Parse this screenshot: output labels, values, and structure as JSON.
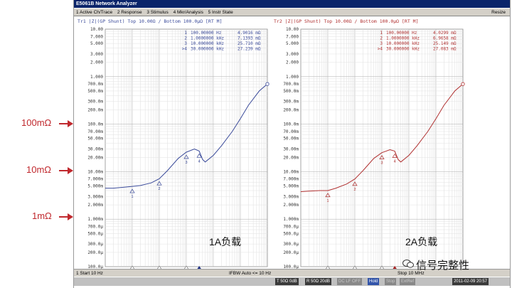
{
  "window": {
    "title": "E5061B Network Analyzer",
    "resize": "Resize"
  },
  "menu": [
    "1 Active Ch/Trace",
    "2 Response",
    "3 Stimulus",
    "4 Mkr/Analysis",
    "5 Instr State"
  ],
  "left_trace": {
    "header": "Tr1 |Z|(GP Shunt)  Top 10.00Ω / Bottom 100.0µΩ [RT M]",
    "color": "#3a4a9a",
    "markers": [
      {
        "id": "1",
        "freq": "100.00000 Hz",
        "val": "4.9016 mΩ"
      },
      {
        "id": "2",
        "freq": "1.0000000 kHz",
        "val": "7.1393 mΩ"
      },
      {
        "id": "3",
        "freq": "10.000000 kHz",
        "val": "25.710 mΩ"
      },
      {
        "id": ">4",
        "freq": "30.000000 kHz",
        "val": "27.239 mΩ"
      }
    ],
    "load_label": "1A负载"
  },
  "right_trace": {
    "header": "Tr2 |Z|(GP Shunt)  Top 10.00Ω / Bottom 100.0µΩ [RT M]",
    "color": "#b03030",
    "markers": [
      {
        "id": "1",
        "freq": "100.00000 Hz",
        "val": "4.0299 mΩ"
      },
      {
        "id": "2",
        "freq": "1.0000000 kHz",
        "val": "6.9658 mΩ"
      },
      {
        "id": "3",
        "freq": "10.000000 kHz",
        "val": "25.149 mΩ"
      },
      {
        "id": ">4",
        "freq": "30.000000 kHz",
        "val": "27.083 mΩ"
      }
    ],
    "load_label": "2A负载"
  },
  "y_ticks": [
    "10.00",
    "7.000",
    "5.000",
    "3.000",
    "2.000",
    "1.000",
    "700.0m",
    "500.0m",
    "300.0m",
    "200.0m",
    "100.0m",
    "70.00m",
    "50.00m",
    "30.00m",
    "20.00m",
    "10.00m",
    "7.000m",
    "5.000m",
    "3.000m",
    "2.000m",
    "1.000m",
    "700.0µ",
    "500.0µ",
    "300.0µ",
    "200.0µ",
    "100.0µ"
  ],
  "annotations": [
    "100mΩ",
    "10mΩ",
    "1mΩ"
  ],
  "status": {
    "start": "1  Start 10 Hz",
    "ifbw": "IFBW Auto <= 10 Hz",
    "stop": "Stop 10 MHz"
  },
  "statusbar": {
    "t": "T 50Ω 0dB",
    "r": "R 50Ω 20dB",
    "dc": "DC LF OFF",
    "hold": "Hold",
    "stop": "Stop",
    "extref": "ExtRef",
    "datetime": "2011-02-09 20:57"
  },
  "watermark": "信号完整性",
  "chart_data": [
    {
      "type": "line",
      "xscale": "log",
      "yscale": "log",
      "xlim": [
        10,
        10000000
      ],
      "ylim": [
        0.0001,
        10
      ],
      "series": [
        {
          "name": "Tr1 |Z|(GP Shunt)",
          "x": [
            10,
            20,
            50,
            100,
            200,
            500,
            1000,
            2000,
            5000,
            10000,
            20000,
            30000,
            40000,
            50000,
            100000,
            200000,
            500000,
            1000000,
            2000000,
            5000000,
            10000000
          ],
          "y": [
            0.0045,
            0.0045,
            0.0047,
            0.0049,
            0.0051,
            0.0058,
            0.0071,
            0.0105,
            0.019,
            0.0257,
            0.03,
            0.0272,
            0.018,
            0.016,
            0.022,
            0.035,
            0.07,
            0.13,
            0.25,
            0.5,
            0.7
          ]
        }
      ],
      "markers": [
        {
          "x": 100,
          "y": 0.0049016
        },
        {
          "x": 1000,
          "y": 0.0071393
        },
        {
          "x": 10000,
          "y": 0.02571
        },
        {
          "x": 30000,
          "y": 0.027239
        }
      ]
    },
    {
      "type": "line",
      "xscale": "log",
      "yscale": "log",
      "xlim": [
        10,
        10000000
      ],
      "ylim": [
        0.0001,
        10
      ],
      "series": [
        {
          "name": "Tr2 |Z|(GP Shunt)",
          "x": [
            10,
            20,
            50,
            100,
            200,
            500,
            1000,
            2000,
            5000,
            10000,
            20000,
            30000,
            40000,
            50000,
            100000,
            200000,
            500000,
            1000000,
            2000000,
            5000000,
            10000000
          ],
          "y": [
            0.0038,
            0.0039,
            0.004,
            0.004,
            0.0045,
            0.0055,
            0.007,
            0.0105,
            0.019,
            0.0251,
            0.029,
            0.0271,
            0.018,
            0.016,
            0.022,
            0.035,
            0.07,
            0.13,
            0.25,
            0.5,
            0.7
          ]
        }
      ],
      "markers": [
        {
          "x": 100,
          "y": 0.0040299
        },
        {
          "x": 1000,
          "y": 0.0069658
        },
        {
          "x": 10000,
          "y": 0.025149
        },
        {
          "x": 30000,
          "y": 0.027083
        }
      ]
    }
  ]
}
